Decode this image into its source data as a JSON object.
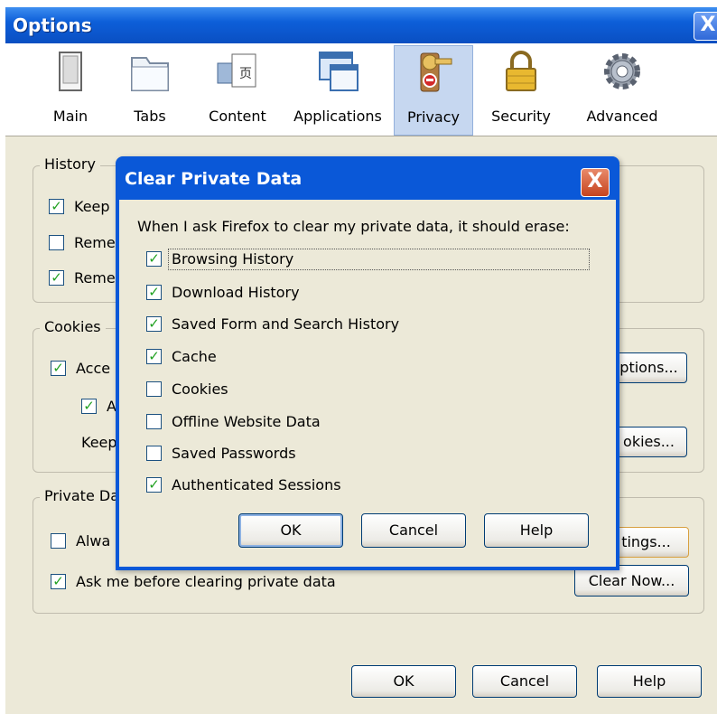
{
  "window": {
    "title": "Options",
    "close": "X"
  },
  "toolbar": {
    "panes": [
      {
        "label": "Main",
        "icon": "main-icon"
      },
      {
        "label": "Tabs",
        "icon": "tabs-icon"
      },
      {
        "label": "Content",
        "icon": "content-icon"
      },
      {
        "label": "Applications",
        "icon": "applications-icon"
      },
      {
        "label": "Privacy",
        "icon": "privacy-icon",
        "selected": true
      },
      {
        "label": "Security",
        "icon": "security-icon"
      },
      {
        "label": "Advanced",
        "icon": "advanced-icon"
      }
    ]
  },
  "history": {
    "title": "History",
    "items": [
      "Keep",
      "Reme",
      "Reme"
    ],
    "checked": [
      true,
      false,
      true
    ]
  },
  "cookies": {
    "title": "Cookies",
    "accept": "Acce",
    "accept_checked": true,
    "sub": "A",
    "sub_checked": true,
    "keep": "Keep",
    "exceptions_label": "ptions...",
    "show_label": "okies..."
  },
  "private_data": {
    "title": "Private Da",
    "always": "Alwa",
    "always_checked": false,
    "ask": "Ask me before clearing private data",
    "ask_checked": true,
    "settings_label": "tings...",
    "clear_label": "Clear Now..."
  },
  "footer": {
    "ok": "OK",
    "cancel": "Cancel",
    "help": "Help"
  },
  "dialog": {
    "title": "Clear Private Data",
    "close": "X",
    "prompt": "When I ask Firefox to clear my private data, it should erase:",
    "items": [
      {
        "label": "Browsing History",
        "checked": true
      },
      {
        "label": "Download History",
        "checked": true
      },
      {
        "label": "Saved Form and Search History",
        "checked": true
      },
      {
        "label": "Cache",
        "checked": true
      },
      {
        "label": "Cookies",
        "checked": false
      },
      {
        "label": "Offline Website Data",
        "checked": false
      },
      {
        "label": "Saved Passwords",
        "checked": false
      },
      {
        "label": "Authenticated Sessions",
        "checked": true
      }
    ],
    "ok": "OK",
    "cancel": "Cancel",
    "help": "Help"
  },
  "colors": {
    "titlebar": "#0a58d8",
    "check": "#21a121",
    "selected_pane": "#c6d7f0"
  }
}
